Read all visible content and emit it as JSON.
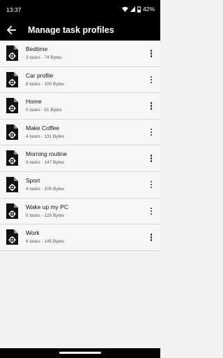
{
  "status": {
    "time": "13:37",
    "battery": "42%"
  },
  "appbar": {
    "title": "Manage task profiles"
  },
  "profiles": [
    {
      "name": "Bedtime",
      "tasks": "3 tasks",
      "size": "74 Bytes"
    },
    {
      "name": "Car profile",
      "tasks": "6 tasks",
      "size": "100 Bytes"
    },
    {
      "name": "Home",
      "tasks": "5 tasks",
      "size": "91 Bytes"
    },
    {
      "name": "Make Coffee",
      "tasks": "4 tasks",
      "size": "131 Bytes"
    },
    {
      "name": "Morning routine",
      "tasks": "9 tasks",
      "size": "147 Bytes"
    },
    {
      "name": "Sport",
      "tasks": "4 tasks",
      "size": "105 Bytes"
    },
    {
      "name": "Wake up my PC",
      "tasks": "5 tasks",
      "size": "125 Bytes"
    },
    {
      "name": "Work",
      "tasks": "6 tasks",
      "size": "145 Bytes"
    }
  ],
  "meta_separator": " - ",
  "icons": {
    "back": "arrow-back-icon",
    "profile": "file-settings-icon",
    "more": "more-vertical-icon"
  }
}
